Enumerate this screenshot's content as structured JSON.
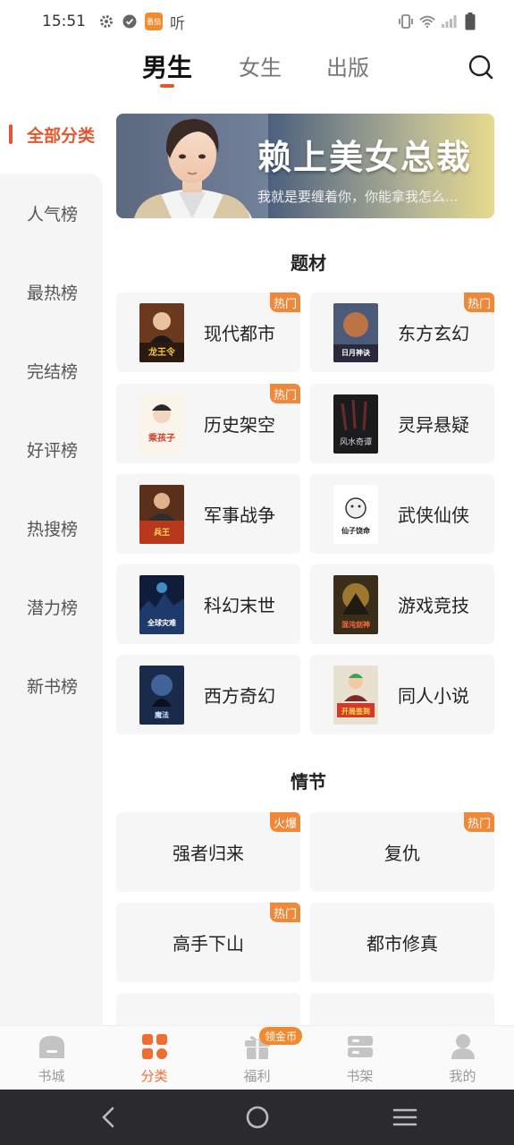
{
  "status_bar": {
    "time": "15:51",
    "app_badge_text": "番茄",
    "listen_label": "听"
  },
  "top_tabs": [
    {
      "label": "男生",
      "active": true
    },
    {
      "label": "女生",
      "active": false
    },
    {
      "label": "出版",
      "active": false
    }
  ],
  "sidebar": {
    "items": [
      {
        "label": "全部分类",
        "active": true
      },
      {
        "label": "人气榜"
      },
      {
        "label": "最热榜"
      },
      {
        "label": "完结榜"
      },
      {
        "label": "好评榜"
      },
      {
        "label": "热搜榜"
      },
      {
        "label": "潜力榜"
      },
      {
        "label": "新书榜"
      }
    ]
  },
  "banner": {
    "title": "赖上美女总裁",
    "subtitle": "我就是要缠着你，你能拿我怎么..."
  },
  "section_theme": {
    "title": "题材",
    "items": [
      {
        "label": "现代都市",
        "badge": "热门",
        "cover_text": "龙王令"
      },
      {
        "label": "东方玄幻",
        "badge": "热门",
        "cover_text": "日月神诀"
      },
      {
        "label": "历史架空",
        "badge": "热门",
        "cover_text": "乘孩子"
      },
      {
        "label": "灵异悬疑",
        "badge": "",
        "cover_text": "风水奇谭"
      },
      {
        "label": "军事战争",
        "badge": "",
        "cover_text": "兵王"
      },
      {
        "label": "武侠仙侠",
        "badge": "",
        "cover_text": "仙子饶命"
      },
      {
        "label": "科幻末世",
        "badge": "",
        "cover_text": "全球灾难"
      },
      {
        "label": "游戏竞技",
        "badge": "",
        "cover_text": "混沌剑神"
      },
      {
        "label": "西方奇幻",
        "badge": "",
        "cover_text": "魔法"
      },
      {
        "label": "同人小说",
        "badge": "",
        "cover_text": "开局签到"
      }
    ]
  },
  "section_plot": {
    "title": "情节",
    "items": [
      {
        "label": "强者归来",
        "badge": "火爆"
      },
      {
        "label": "复仇",
        "badge": "热门"
      },
      {
        "label": "高手下山",
        "badge": "热门"
      },
      {
        "label": "都市修真",
        "badge": ""
      }
    ]
  },
  "bottom_nav": {
    "items": [
      {
        "label": "书城",
        "active": false
      },
      {
        "label": "分类",
        "active": true
      },
      {
        "label": "福利",
        "active": false
      },
      {
        "label": "书架",
        "active": false
      },
      {
        "label": "我的",
        "active": false
      }
    ],
    "coin_badge": "领金币"
  },
  "colors": {
    "accent": "#e4572e",
    "badge": "#f0883a",
    "card_bg": "#f6f6f6",
    "system_nav": "#2b2b2f"
  },
  "icons": [
    "settings-icon",
    "check-circle-icon",
    "vibrate-icon",
    "wifi-icon",
    "signal-icon",
    "battery-icon",
    "search-icon",
    "home-icon",
    "category-icon",
    "gift-icon",
    "bookshelf-icon",
    "profile-icon",
    "back-icon",
    "home-circle-icon",
    "menu-icon"
  ]
}
